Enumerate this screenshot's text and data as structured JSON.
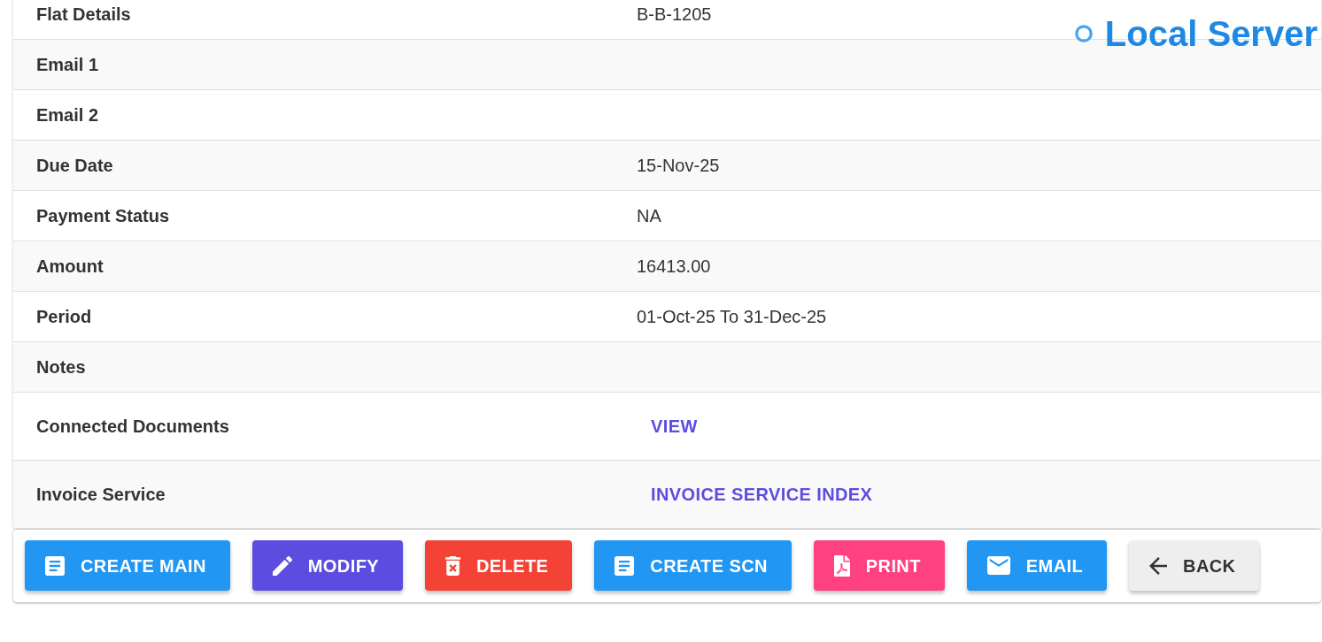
{
  "server_indicator": {
    "label": "Local Server"
  },
  "details": {
    "rows": [
      {
        "label": "Flat Details",
        "kind": "text",
        "value": "B-B-1205"
      },
      {
        "label": "Email 1",
        "kind": "text"
      },
      {
        "label": "Email 2",
        "kind": "text"
      },
      {
        "label": "Due Date",
        "kind": "text",
        "value": "15-Nov-25"
      },
      {
        "label": "Payment Status",
        "kind": "text",
        "value": "NA"
      },
      {
        "label": "Amount",
        "kind": "text",
        "value": "16413.00"
      },
      {
        "label": "Period",
        "kind": "text",
        "value": "01-Oct-25 To 31-Dec-25"
      },
      {
        "label": "Notes",
        "kind": "text"
      },
      {
        "label": "Connected Documents",
        "kind": "link",
        "value": "VIEW"
      },
      {
        "label": "Invoice Service",
        "kind": "link",
        "value": "INVOICE SERVICE INDEX"
      }
    ]
  },
  "actions": [
    {
      "label": "CREATE MAIN",
      "kind": "create",
      "color": "#2196f3"
    },
    {
      "label": "MODIFY",
      "kind": "modify",
      "color": "#5c4de0"
    },
    {
      "label": "DELETE",
      "kind": "delete",
      "color": "#f44336"
    },
    {
      "label": "CREATE SCN",
      "kind": "create",
      "color": "#2196f3"
    },
    {
      "label": "PRINT",
      "kind": "print",
      "color": "#ff4081"
    },
    {
      "label": "EMAIL",
      "kind": "email",
      "color": "#2196f3"
    },
    {
      "label": "BACK",
      "kind": "back",
      "color": "#eeeeee"
    }
  ]
}
